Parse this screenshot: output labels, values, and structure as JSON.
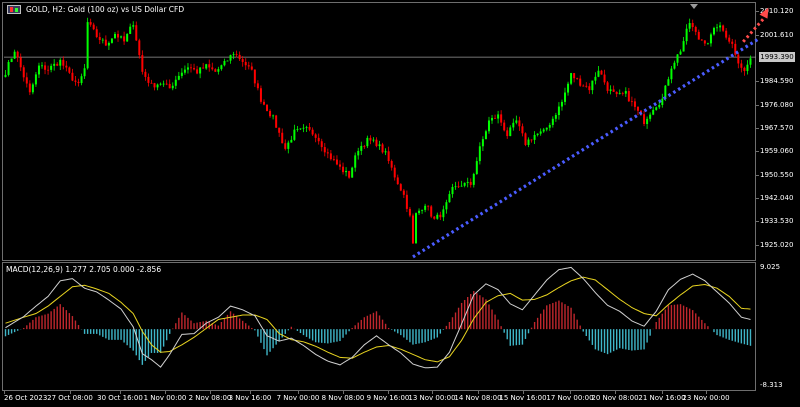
{
  "window": {
    "title": "GOLD, H2:  Gold (100 oz) vs US Dollar CFD"
  },
  "macd_panel": {
    "title": "MACD(12,26,9) 1.277 2.705 0.000 -2.856",
    "scale_top": "9.025",
    "scale_bottom": "-8.313"
  },
  "current_price": {
    "label": "1993.390",
    "value": 1993.39
  },
  "colors": {
    "background": "#000000",
    "bull": "#00ff00",
    "bear": "#ff0000",
    "histogram_positive": "#c0272d",
    "histogram_negative": "#3fb6c8",
    "macd_line": "#d0d0d0",
    "signal_line": "#e8d420",
    "trendline": "#4a5cff",
    "arrow": "#ff4a4a",
    "grid": "#6e6e6e",
    "current_price_line": "#9a9a9a"
  },
  "chart_data": [
    {
      "type": "candlestick",
      "title": "GOLD, H2:  Gold (100 oz) vs US Dollar CFD",
      "ylim": [
        1919.0,
        2013.5
      ],
      "y_ticks": [
        "2010.120",
        "2001.610",
        "1993.390",
        "1984.590",
        "1976.080",
        "1967.570",
        "1959.060",
        "1950.550",
        "1942.040",
        "1933.530",
        "1925.020"
      ],
      "x_labels": [
        "26 Oct 2023",
        "27 Oct 08:00",
        "30 Oct 16:00",
        "1 Nov 00:00",
        "2 Nov 08:00",
        "3 Nov 16:00",
        "7 Nov 00:00",
        "8 Nov 08:00",
        "9 Nov 16:00",
        "13 Nov 00:00",
        "14 Nov 08:00",
        "15 Nov 16:00",
        "17 Nov 00:00",
        "20 Nov 08:00",
        "21 Nov 16:00",
        "23 Nov 00:00"
      ],
      "anchors": [
        [
          0,
          1988
        ],
        [
          3,
          1996
        ],
        [
          8,
          1980
        ],
        [
          11,
          1990
        ],
        [
          14,
          1989
        ],
        [
          18,
          1992
        ],
        [
          21,
          1987
        ],
        [
          24,
          1983
        ],
        [
          26,
          1989
        ],
        [
          27,
          2006
        ],
        [
          30,
          2001
        ],
        [
          33,
          1998
        ],
        [
          36,
          2002
        ],
        [
          39,
          1999
        ],
        [
          42,
          2006
        ],
        [
          45,
          1988
        ],
        [
          48,
          1983
        ],
        [
          51,
          1984
        ],
        [
          54,
          1982
        ],
        [
          57,
          1987
        ],
        [
          60,
          1990
        ],
        [
          63,
          1988
        ],
        [
          66,
          1990
        ],
        [
          69,
          1988
        ],
        [
          72,
          1991
        ],
        [
          75,
          1995
        ],
        [
          78,
          1992
        ],
        [
          81,
          1988
        ],
        [
          84,
          1978
        ],
        [
          88,
          1971
        ],
        [
          92,
          1960
        ],
        [
          95,
          1966
        ],
        [
          99,
          1967
        ],
        [
          102,
          1965
        ],
        [
          106,
          1958
        ],
        [
          110,
          1953
        ],
        [
          113,
          1950
        ],
        [
          116,
          1960
        ],
        [
          119,
          1963
        ],
        [
          122,
          1962
        ],
        [
          125,
          1958
        ],
        [
          128,
          1950
        ],
        [
          131,
          1943
        ],
        [
          133,
          1935
        ],
        [
          134,
          1925
        ],
        [
          135,
          1936
        ],
        [
          138,
          1940
        ],
        [
          141,
          1934
        ],
        [
          144,
          1937
        ],
        [
          147,
          1945
        ],
        [
          150,
          1947
        ],
        [
          153,
          1947
        ],
        [
          156,
          1960
        ],
        [
          159,
          1970
        ],
        [
          162,
          1972
        ],
        [
          165,
          1965
        ],
        [
          168,
          1970
        ],
        [
          171,
          1962
        ],
        [
          174,
          1965
        ],
        [
          177,
          1966
        ],
        [
          180,
          1971
        ],
        [
          183,
          1977
        ],
        [
          186,
          1987
        ],
        [
          189,
          1984
        ],
        [
          192,
          1982
        ],
        [
          195,
          1989
        ],
        [
          198,
          1982
        ],
        [
          201,
          1979
        ],
        [
          204,
          1980
        ],
        [
          207,
          1975
        ],
        [
          210,
          1970
        ],
        [
          213,
          1975
        ],
        [
          216,
          1978
        ],
        [
          219,
          1990
        ],
        [
          222,
          1996
        ],
        [
          225,
          2006
        ],
        [
          228,
          2000
        ],
        [
          231,
          1999
        ],
        [
          234,
          2005
        ],
        [
          236,
          2003
        ],
        [
          239,
          1998
        ],
        [
          241,
          1992
        ],
        [
          243,
          1988
        ],
        [
          245,
          1993
        ]
      ],
      "trendline": {
        "from": [
          134,
          1920.5
        ],
        "to": [
          245,
          2000
        ]
      },
      "arrow": {
        "from": [
          238,
          1999
        ],
        "to": [
          245,
          2010
        ]
      }
    },
    {
      "type": "macd",
      "title": "MACD(12,26,9) 1.277 2.705 0.000 -2.856",
      "ylim": [
        -8.313,
        9.025
      ],
      "series": [
        {
          "name": "MACD",
          "anchors": [
            [
              0,
              0.2
            ],
            [
              6,
              1.7
            ],
            [
              10,
              3.1
            ],
            [
              14,
              4.4
            ],
            [
              18,
              6.5
            ],
            [
              22,
              6.8
            ],
            [
              26,
              5.5
            ],
            [
              30,
              5.0
            ],
            [
              34,
              3.9
            ],
            [
              38,
              2.7
            ],
            [
              42,
              0.3
            ],
            [
              45,
              -3.3
            ],
            [
              48,
              -4.1
            ],
            [
              51,
              -5.1
            ],
            [
              54,
              -3.4
            ],
            [
              58,
              -0.7
            ],
            [
              62,
              -0.6
            ],
            [
              66,
              0.8
            ],
            [
              70,
              1.6
            ],
            [
              74,
              3.1
            ],
            [
              78,
              2.6
            ],
            [
              82,
              1.8
            ],
            [
              86,
              -0.9
            ],
            [
              90,
              -1.6
            ],
            [
              94,
              -1.2
            ],
            [
              98,
              -2.2
            ],
            [
              102,
              -3.4
            ],
            [
              106,
              -4.3
            ],
            [
              110,
              -4.8
            ],
            [
              114,
              -3.8
            ],
            [
              118,
              -2.1
            ],
            [
              122,
              -0.9
            ],
            [
              126,
              -2.1
            ],
            [
              130,
              -3.2
            ],
            [
              134,
              -4.7
            ],
            [
              138,
              -5.2
            ],
            [
              142,
              -5.1
            ],
            [
              146,
              -3.1
            ],
            [
              150,
              0.7
            ],
            [
              154,
              4.6
            ],
            [
              158,
              6.1
            ],
            [
              162,
              5.3
            ],
            [
              166,
              3.4
            ],
            [
              170,
              2.6
            ],
            [
              174,
              4.6
            ],
            [
              178,
              6.6
            ],
            [
              182,
              8.0
            ],
            [
              186,
              8.3
            ],
            [
              190,
              6.8
            ],
            [
              194,
              4.9
            ],
            [
              198,
              3.2
            ],
            [
              202,
              2.4
            ],
            [
              206,
              1.1
            ],
            [
              210,
              0.4
            ],
            [
              214,
              2.4
            ],
            [
              218,
              5.3
            ],
            [
              222,
              6.7
            ],
            [
              226,
              7.4
            ],
            [
              230,
              6.5
            ],
            [
              234,
              5.0
            ],
            [
              238,
              3.5
            ],
            [
              242,
              1.6
            ],
            [
              245,
              1.3
            ]
          ]
        },
        {
          "name": "Signal",
          "anchors": [
            [
              0,
              0.8
            ],
            [
              6,
              1.6
            ],
            [
              10,
              2.1
            ],
            [
              14,
              3.1
            ],
            [
              18,
              4.4
            ],
            [
              22,
              5.7
            ],
            [
              26,
              5.9
            ],
            [
              30,
              5.4
            ],
            [
              34,
              4.8
            ],
            [
              38,
              3.6
            ],
            [
              42,
              2.1
            ],
            [
              45,
              -0.3
            ],
            [
              48,
              -2.1
            ],
            [
              51,
              -3.1
            ],
            [
              54,
              -3.0
            ],
            [
              58,
              -2.1
            ],
            [
              62,
              -1.1
            ],
            [
              66,
              0.1
            ],
            [
              70,
              1.3
            ],
            [
              74,
              1.6
            ],
            [
              78,
              1.9
            ],
            [
              82,
              1.9
            ],
            [
              86,
              1.3
            ],
            [
              90,
              -0.6
            ],
            [
              94,
              -1.4
            ],
            [
              98,
              -1.7
            ],
            [
              102,
              -2.3
            ],
            [
              106,
              -3.1
            ],
            [
              110,
              -3.8
            ],
            [
              114,
              -3.9
            ],
            [
              118,
              -3.1
            ],
            [
              122,
              -2.4
            ],
            [
              126,
              -2.2
            ],
            [
              130,
              -2.7
            ],
            [
              134,
              -3.4
            ],
            [
              138,
              -4.1
            ],
            [
              142,
              -4.4
            ],
            [
              146,
              -3.7
            ],
            [
              150,
              -1.5
            ],
            [
              154,
              1.4
            ],
            [
              158,
              3.6
            ],
            [
              162,
              4.5
            ],
            [
              166,
              4.8
            ],
            [
              170,
              3.9
            ],
            [
              174,
              4.0
            ],
            [
              178,
              4.6
            ],
            [
              182,
              5.6
            ],
            [
              186,
              6.5
            ],
            [
              190,
              7.0
            ],
            [
              194,
              6.6
            ],
            [
              198,
              5.3
            ],
            [
              202,
              4.0
            ],
            [
              206,
              2.9
            ],
            [
              210,
              2.1
            ],
            [
              214,
              1.8
            ],
            [
              218,
              3.3
            ],
            [
              222,
              4.6
            ],
            [
              226,
              5.8
            ],
            [
              230,
              6.0
            ],
            [
              234,
              5.5
            ],
            [
              238,
              4.4
            ],
            [
              242,
              2.8
            ],
            [
              245,
              2.7
            ]
          ]
        }
      ]
    }
  ]
}
